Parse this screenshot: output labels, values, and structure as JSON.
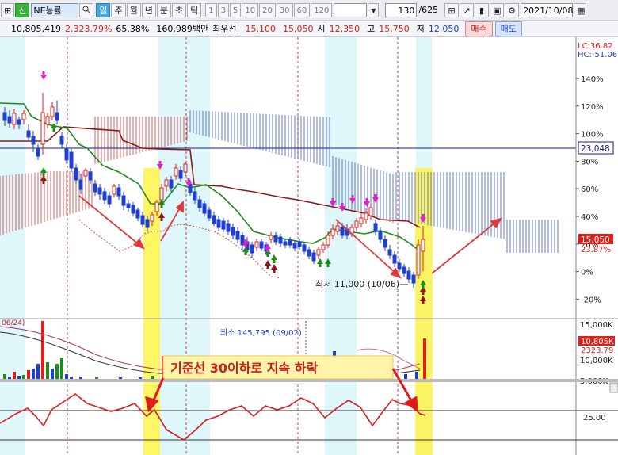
{
  "toolbar": {
    "menu_glyph": "⊞",
    "market_tag": "신",
    "stock_name": "NE능률",
    "periods": [
      "일",
      "주",
      "월",
      "년",
      "분",
      "초",
      "틱"
    ],
    "active_period": "일",
    "intervals": [
      "1",
      "3",
      "5",
      "10",
      "20",
      "30",
      "60",
      "120"
    ],
    "count_value": "130",
    "count_total": "/625",
    "date_value": "2021/10/08"
  },
  "info": {
    "volume": "10,805,419",
    "volume_rate": "2,323.79%",
    "turnover": "65.38%",
    "amount": "160,989백만",
    "best_ask_label": "최우선",
    "best_ask": "15,100",
    "best_bid": "15,050",
    "open_label": "시",
    "open": "12,350",
    "high_label": "고",
    "high": "15,750",
    "low_label": "저",
    "low": "12,050",
    "buy_label": "매수",
    "sell_label": "매도"
  },
  "chart": {
    "lc_label": "LC:36.82",
    "hc_label": "HC:-51.06",
    "y_ticks": [
      "140%",
      "120%",
      "100%",
      "80%",
      "60%",
      "40%",
      "20%",
      "0%",
      "-20%"
    ],
    "ref_price": "23,048",
    "current_price": "15,050",
    "current_pct": "23.87%",
    "low_annotation": "최저 11,000 (10/06)",
    "volume_min_annotation": "최소 145,795 (09/02)",
    "volume_ticks": [
      "15,000K",
      "10,000K",
      "5,000K"
    ],
    "volume_value": "10,805K",
    "volume_pct": "2323.79",
    "volume_partial": "06/24)",
    "osc_tick": "25.00",
    "callout": "기준선 30이하로 지속 하락",
    "colors": {
      "up": "#e0201a",
      "down": "#1f3fd0",
      "highlight": "#fff34a",
      "band": "#dff6fb",
      "baseline": "#8b1a1a",
      "conversion": "#1c8c1c"
    }
  }
}
